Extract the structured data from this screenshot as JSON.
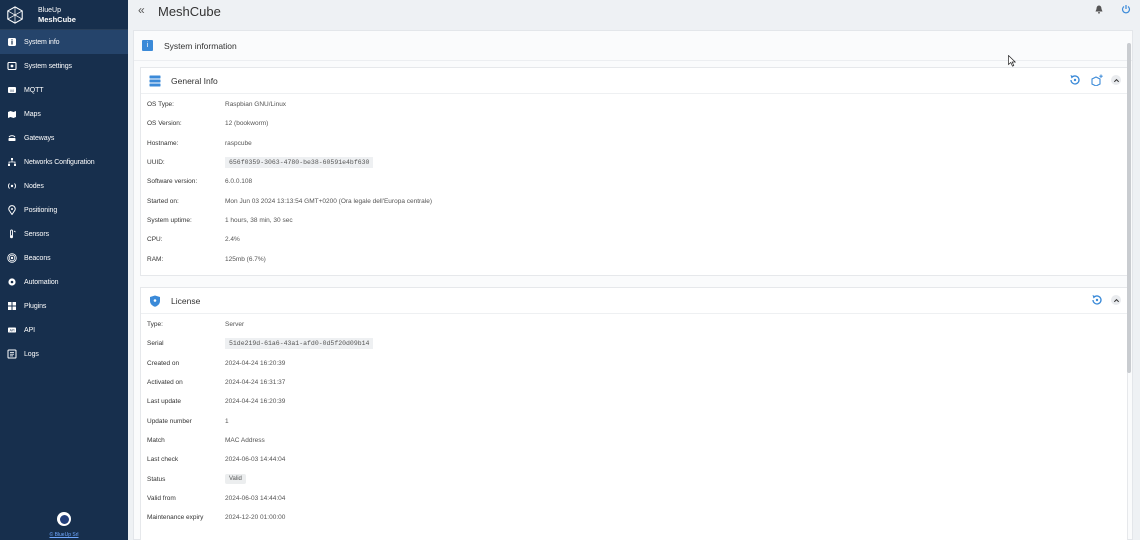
{
  "brand": {
    "line1": "BlueUp",
    "line2": "MeshCube"
  },
  "sidebar": {
    "items": [
      {
        "label": "System info",
        "icon": "info-icon",
        "active": true
      },
      {
        "label": "System settings",
        "icon": "settings-icon"
      },
      {
        "label": "MQTT",
        "icon": "mqtt-icon"
      },
      {
        "label": "Maps",
        "icon": "map-icon"
      },
      {
        "label": "Gateways",
        "icon": "gateway-icon"
      },
      {
        "label": "Networks Configuration",
        "icon": "network-icon"
      },
      {
        "label": "Nodes",
        "icon": "nodes-icon"
      },
      {
        "label": "Positioning",
        "icon": "location-pin-icon"
      },
      {
        "label": "Sensors",
        "icon": "sensor-icon"
      },
      {
        "label": "Beacons",
        "icon": "beacon-icon"
      },
      {
        "label": "Automation",
        "icon": "automation-icon"
      },
      {
        "label": "Plugins",
        "icon": "plugins-icon"
      },
      {
        "label": "API",
        "icon": "api-icon"
      },
      {
        "label": "Logs",
        "icon": "logs-icon"
      }
    ],
    "footer": "© BlueUp Srl"
  },
  "topbar": {
    "title": "MeshCube",
    "collapse_glyph": "«"
  },
  "page": {
    "header_title": "System information",
    "info_glyph": "i"
  },
  "general": {
    "title": "General Info",
    "rows": [
      {
        "key": "OS Type:",
        "value": "Raspbian GNU/Linux"
      },
      {
        "key": "OS Version:",
        "value": "12 (bookworm)"
      },
      {
        "key": "Hostname:",
        "value": "raspcube"
      },
      {
        "key": "UUID:",
        "value": "656f0359-3063-4780-be38-60591e4bf630"
      },
      {
        "key": "Software version:",
        "value": "6.0.0.108"
      },
      {
        "key": "Started on:",
        "value": "Mon Jun 03 2024 13:13:54 GMT+0200 (Ora legale dell'Europa centrale)"
      },
      {
        "key": "System uptime:",
        "value": "1 hours, 38 min, 30 sec"
      },
      {
        "key": "CPU:",
        "value": "2.4%"
      },
      {
        "key": "RAM:",
        "value": "125mb (6.7%)"
      }
    ]
  },
  "license": {
    "title": "License",
    "rows": [
      {
        "key": "Type:",
        "value": "Server"
      },
      {
        "key": "Serial",
        "value": "51de219d-61a6-43a1-afd0-0d5f20d09b14"
      },
      {
        "key": "Created on",
        "value": "2024-04-24 16:20:39"
      },
      {
        "key": "Activated on",
        "value": "2024-04-24 16:31:37"
      },
      {
        "key": "Last update",
        "value": "2024-04-24 16:20:39"
      },
      {
        "key": "Update number",
        "value": "1"
      },
      {
        "key": "Match",
        "value": "MAC Address"
      },
      {
        "key": "Last check",
        "value": "2024-06-03 14:44:04"
      },
      {
        "key": "Status",
        "value": "Valid"
      },
      {
        "key": "Valid from",
        "value": "2024-06-03 14:44:04"
      },
      {
        "key": "Maintenance expiry",
        "value": "2024-12-20 01:00:00"
      }
    ]
  },
  "colors": {
    "sidebar_bg": "#172f4d",
    "accent": "#3b8ad8",
    "active_item": "#25446b"
  }
}
